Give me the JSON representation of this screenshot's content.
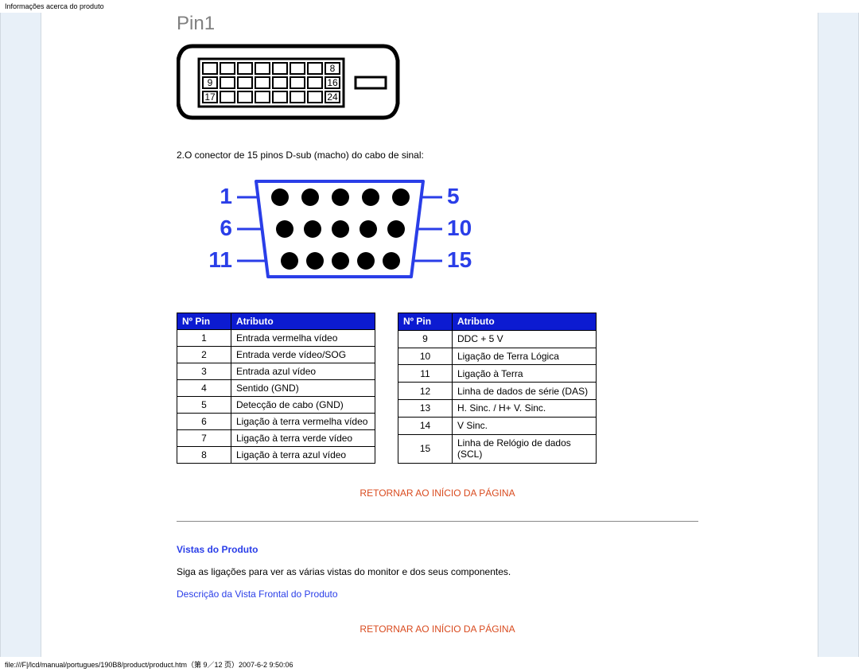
{
  "header": "Informações acerca do produto",
  "dvi": {
    "label": "Pin1",
    "slot_nums": [
      "8",
      "9",
      "16",
      "17",
      "24"
    ]
  },
  "caption": "2.O conector de 15 pinos D-sub (macho) do cabo de sinal:",
  "vga": {
    "left": [
      "1",
      "6",
      "11"
    ],
    "right": [
      "5",
      "10",
      "15"
    ]
  },
  "headers": {
    "pin": "Nº Pin",
    "attr": "Atributo"
  },
  "tableA": [
    {
      "n": "1",
      "a": "Entrada vermelha vídeo"
    },
    {
      "n": "2",
      "a": "Entrada verde vídeo/SOG"
    },
    {
      "n": "3",
      "a": "Entrada azul vídeo"
    },
    {
      "n": "4",
      "a": "Sentido (GND)"
    },
    {
      "n": "5",
      "a": "Detecção de cabo (GND)"
    },
    {
      "n": "6",
      "a": "Ligação à terra vermelha vídeo"
    },
    {
      "n": "7",
      "a": "Ligação à terra verde vídeo"
    },
    {
      "n": "8",
      "a": "Ligação à terra azul vídeo"
    }
  ],
  "tableB": [
    {
      "n": "9",
      "a": "DDC + 5 V"
    },
    {
      "n": "10",
      "a": "Ligação de Terra Lógica"
    },
    {
      "n": "11",
      "a": "Ligação à Terra"
    },
    {
      "n": "12",
      "a": "Linha de dados de série (DAS)"
    },
    {
      "n": "13",
      "a": "H. Sinc. / H+ V. Sinc."
    },
    {
      "n": "14",
      "a": "V Sinc."
    },
    {
      "n": "15",
      "a": "Linha de Relógio de dados (SCL)"
    }
  ],
  "links": {
    "return": "RETORNAR AO INÍCIO DA PÁGINA",
    "section": "Vistas do Produto",
    "sectionText": "Siga as ligações para ver as várias vistas do monitor e dos seus componentes.",
    "frontView": "Descrição da Vista Frontal do Produto"
  },
  "footer": "file:///F|/lcd/manual/portugues/190B8/product/product.htm（第 9／12 页）2007-6-2 9:50:06"
}
